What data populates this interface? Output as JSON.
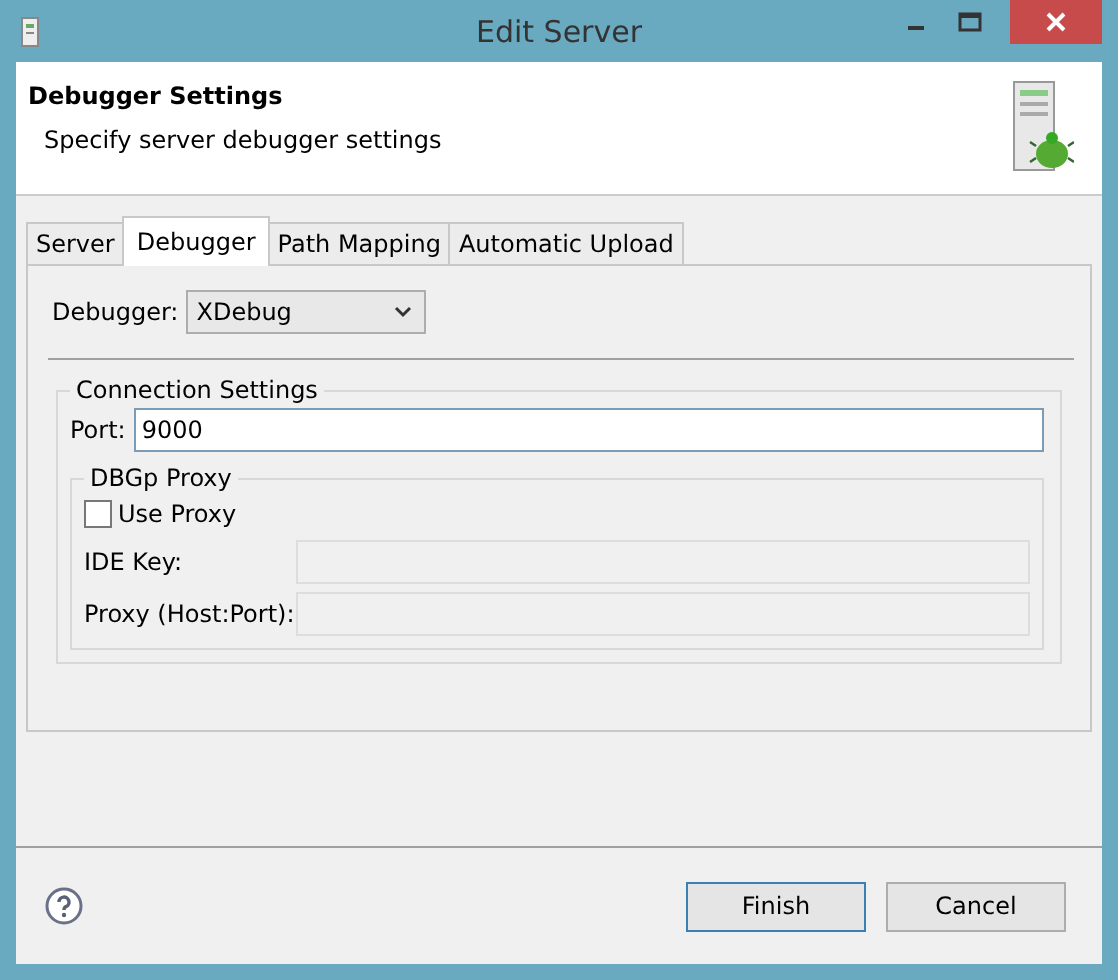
{
  "window": {
    "title": "Edit Server"
  },
  "header": {
    "title": "Debugger Settings",
    "description": "Specify server debugger settings"
  },
  "tabs": [
    {
      "label": "Server",
      "selected": false
    },
    {
      "label": "Debugger",
      "selected": true
    },
    {
      "label": "Path Mapping",
      "selected": false
    },
    {
      "label": "Automatic Upload",
      "selected": false
    }
  ],
  "debugger": {
    "label": "Debugger:",
    "value": "XDebug"
  },
  "connection_settings": {
    "title": "Connection Settings",
    "port_label": "Port:",
    "port_value": "9000",
    "proxy": {
      "title": "DBGp Proxy",
      "use_proxy": {
        "label": "Use Proxy",
        "checked": false
      },
      "fields": [
        {
          "label": "IDE Key:",
          "disabled": true
        },
        {
          "label": "Proxy (Host:Port):",
          "disabled": true
        }
      ]
    }
  },
  "buttons": [
    {
      "label": "Finish",
      "default": true
    },
    {
      "label": "Cancel",
      "default": false
    }
  ]
}
